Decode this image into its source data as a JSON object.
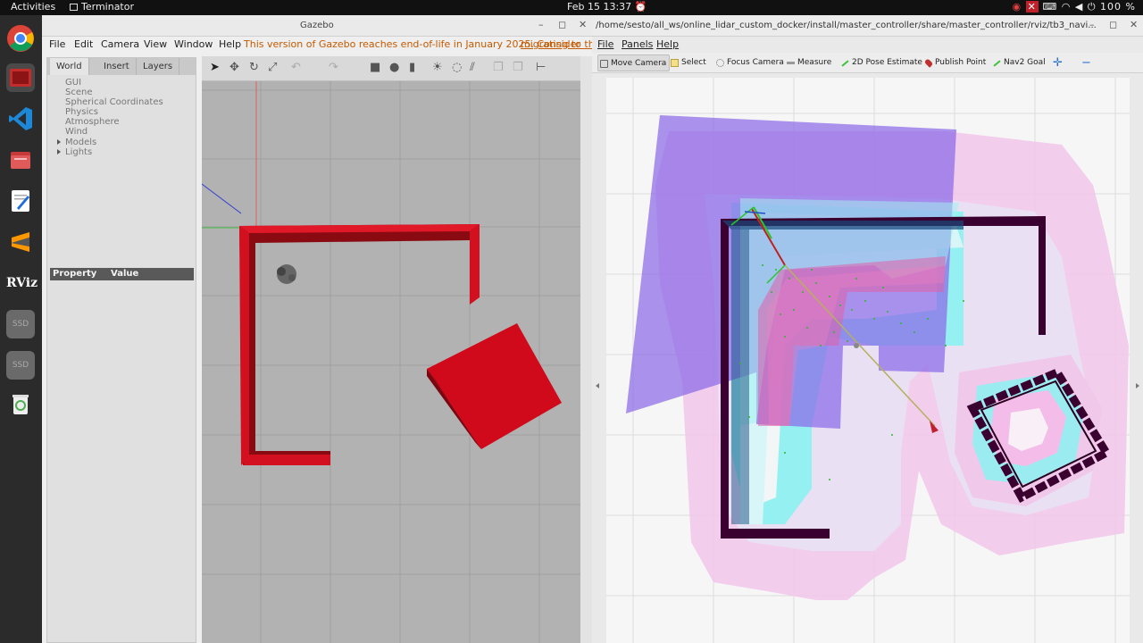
{
  "topbar": {
    "activities": "Activities",
    "app_name": "Terminator",
    "datetime": "Feb 15  13:37",
    "battery": "100 %"
  },
  "dock": {
    "items": [
      "chrome-icon",
      "terminator-icon",
      "vscode-icon",
      "files-icon",
      "text-editor-icon",
      "sublime-icon",
      "rviz-icon",
      "ssd-drive-icon",
      "ssd-drive-icon",
      "trash-icon"
    ],
    "rviz_label": "RViz",
    "ssd_label": "SSD"
  },
  "gazebo": {
    "title": "Gazebo",
    "menu": [
      "File",
      "Edit",
      "Camera",
      "View",
      "Window",
      "Help"
    ],
    "notice": "This version of Gazebo reaches end-of-life in January 2025. Consider",
    "notice_link": "migrating to the n",
    "tabs": [
      "World",
      "Insert",
      "Layers"
    ],
    "tree": [
      "GUI",
      "Scene",
      "Spherical Coordinates",
      "Physics",
      "Atmosphere",
      "Wind",
      "Models",
      "Lights"
    ],
    "property_header": "Property",
    "value_header": "Value"
  },
  "rviz": {
    "title": "/home/sesto/all_ws/online_lidar_custom_docker/install/master_controller/share/master_controller/rviz/tb3_navi...",
    "menu": [
      "File",
      "Panels",
      "Help"
    ],
    "tools": [
      "Move Camera",
      "Select",
      "Focus Camera",
      "Measure",
      "2D Pose Estimate",
      "Publish Point",
      "Nav2 Goal"
    ],
    "tool_colors": {
      "select": "#f5e08a",
      "pose": "#3cc43c",
      "publish": "#c03030",
      "nav2": "#3cc43c",
      "plus": "#2a6ed8"
    }
  },
  "colors": {
    "gazebo_walls": "#d21020",
    "gazebo_ground": "#b2b2b2",
    "costmap_purple": "#8a6ae8",
    "inflation_cyan": "#8cf2f2",
    "inflation_pink": "#f2b8e6",
    "obstacle": "#3a0030"
  }
}
